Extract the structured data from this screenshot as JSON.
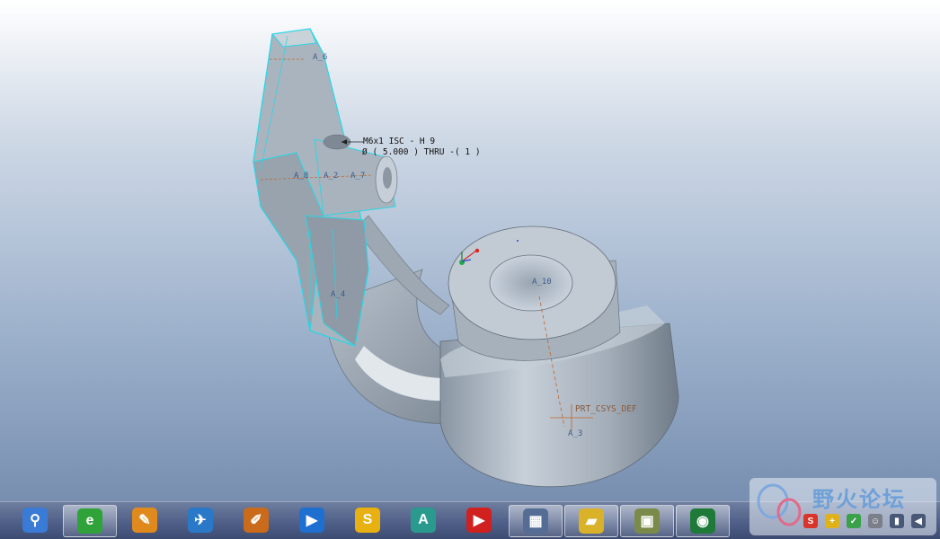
{
  "annotations": {
    "hole_note_line1": "M6x1 ISC - H 9",
    "hole_note_line2": "Ø ( 5.000 )  THRU  -( 1 )",
    "axis_a6": "A_6",
    "axis_a8": "A_8",
    "axis_a2": "A_2",
    "axis_a7": "A_7",
    "axis_a4": "A_4",
    "axis_a10": "A_10",
    "csys_label": "PRT_CSYS_DEF",
    "axis_a3": "A_3"
  },
  "taskbar": {
    "items": [
      {
        "name": "search-app",
        "color": "#3a7bd5",
        "glyph": "⚲"
      },
      {
        "name": "ie-browser",
        "color": "#2fa33a",
        "glyph": "e"
      },
      {
        "name": "draw-app",
        "color": "#e08a1e",
        "glyph": "✎"
      },
      {
        "name": "bird-app",
        "color": "#2a78c8",
        "glyph": "✈"
      },
      {
        "name": "paint-app",
        "color": "#c96b1a",
        "glyph": "✐"
      },
      {
        "name": "media-app",
        "color": "#1e6fd0",
        "glyph": "▶"
      },
      {
        "name": "sogou-app",
        "color": "#e8b010",
        "glyph": "S"
      },
      {
        "name": "cad-app",
        "color": "#2b9a8e",
        "glyph": "A"
      },
      {
        "name": "video-app",
        "color": "#d02020",
        "glyph": "▶"
      },
      {
        "name": "proe-window",
        "color": "#556c95",
        "glyph": "▦"
      },
      {
        "name": "folder-app",
        "color": "#d9b22a",
        "glyph": "▰"
      },
      {
        "name": "photo-app",
        "color": "#7a8a4a",
        "glyph": "▣"
      },
      {
        "name": "eye-app",
        "color": "#1f7a3a",
        "glyph": "◉"
      }
    ]
  },
  "watermark": {
    "text": "野火论坛"
  }
}
